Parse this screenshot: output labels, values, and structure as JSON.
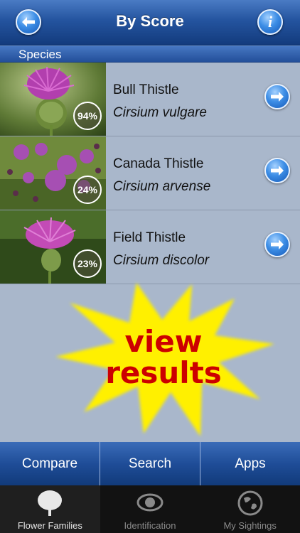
{
  "header": {
    "title": "By Score",
    "back_icon": "back-arrow-icon",
    "info_label": "i"
  },
  "section": {
    "title": "Species"
  },
  "species": [
    {
      "common": "Bull Thistle",
      "latin": "Cirsium vulgare",
      "score": "94%"
    },
    {
      "common": "Canada Thistle",
      "latin": "Cirsium arvense",
      "score": "24%"
    },
    {
      "common": "Field Thistle",
      "latin": "Cirsium discolor",
      "score": "23%"
    }
  ],
  "promo": {
    "line1": "view",
    "line2": "results"
  },
  "toolbar": {
    "compare": "Compare",
    "search": "Search",
    "apps": "Apps"
  },
  "tabs": [
    {
      "label": "Flower Families",
      "icon": "tree-icon",
      "active": true
    },
    {
      "label": "Identification",
      "icon": "eye-icon",
      "active": false
    },
    {
      "label": "My Sightings",
      "icon": "globe-icon",
      "active": false
    }
  ],
  "colors": {
    "header_blue": "#24549f",
    "list_bg": "#a9b7cb",
    "promo_yellow": "#fff000",
    "promo_text": "#cc0000"
  }
}
